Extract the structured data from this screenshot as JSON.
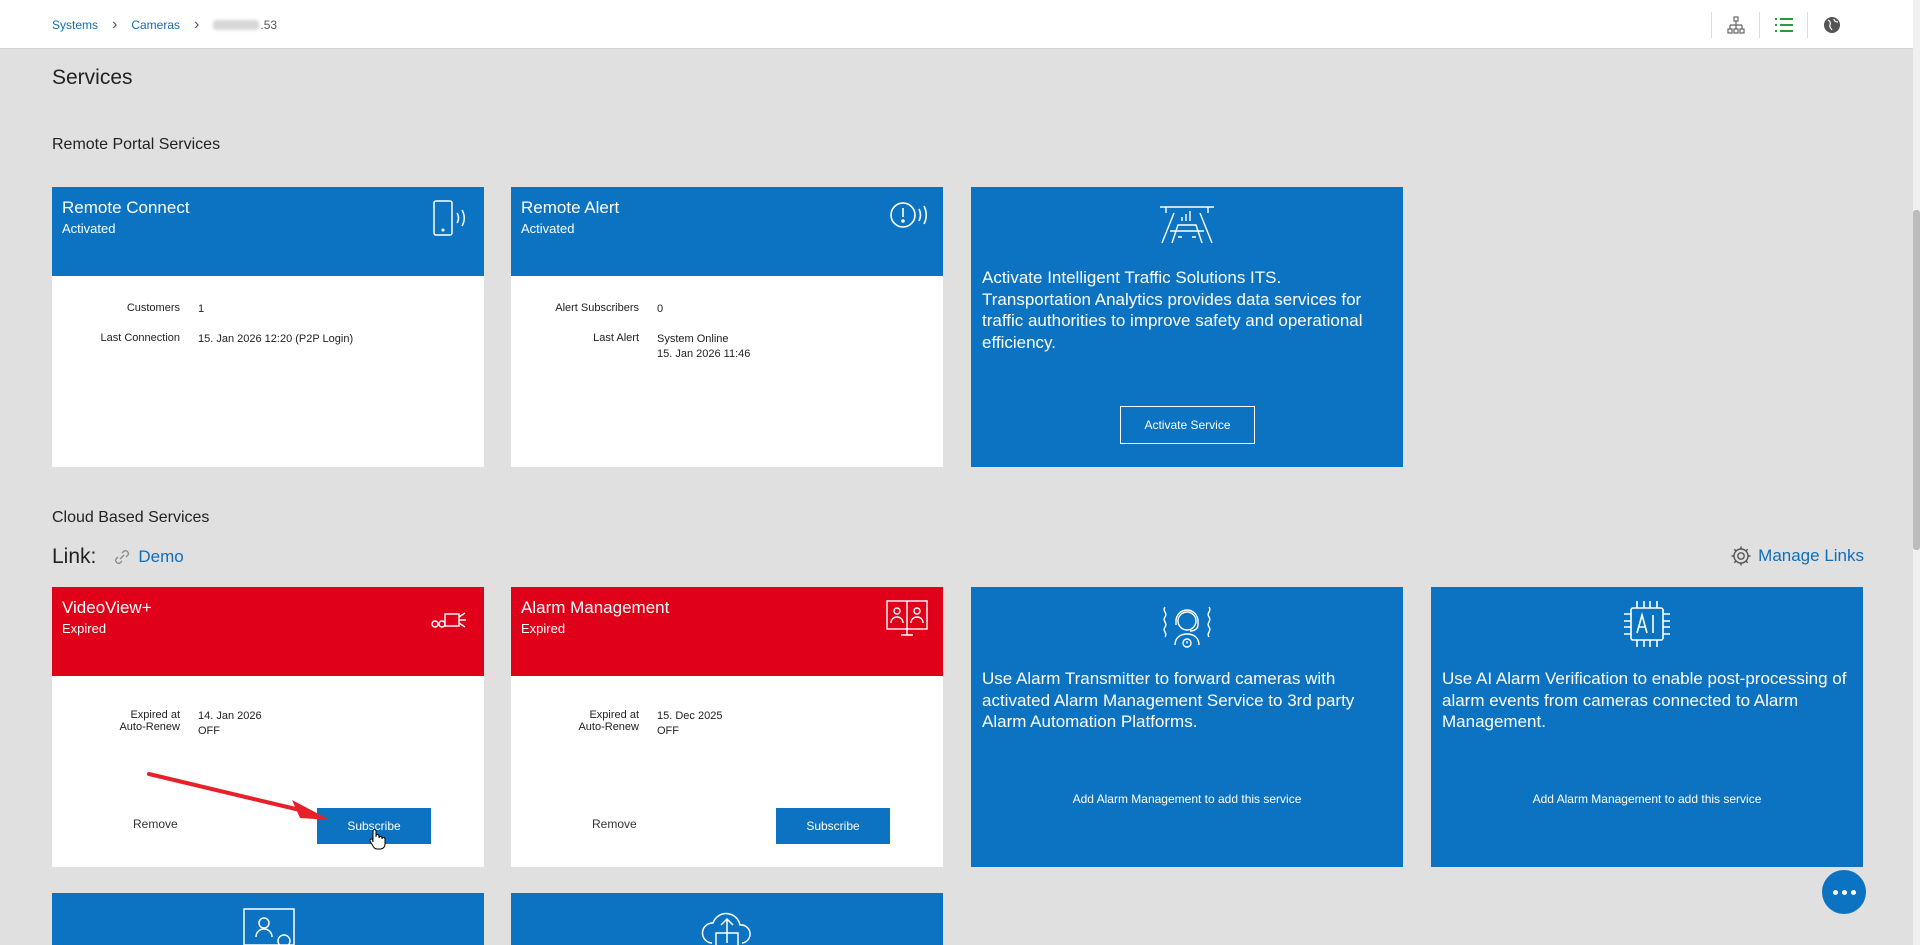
{
  "breadcrumb": {
    "systems": "Systems",
    "cameras": "Cameras",
    "device_suffix": ".53"
  },
  "page": {
    "title": "Services"
  },
  "sections": {
    "remote_portal": "Remote Portal Services",
    "cloud_based": "Cloud Based Services"
  },
  "link_row": {
    "label": "Link:",
    "demo": "Demo",
    "manage": "Manage Links"
  },
  "remote_connect": {
    "title": "Remote Connect",
    "status": "Activated",
    "rows": [
      {
        "label": "Customers",
        "value": "1"
      },
      {
        "label": "Last Connection",
        "value": "15. Jan 2026 12:20 (P2P Login)"
      }
    ]
  },
  "remote_alert": {
    "title": "Remote Alert",
    "status": "Activated",
    "rows": [
      {
        "label": "Alert Subscribers",
        "value": "0"
      },
      {
        "label": "Last Alert",
        "value": "System Online",
        "value2": "15. Jan 2026 11:46"
      }
    ]
  },
  "its_promo": {
    "text": "Activate Intelligent Traffic Solutions ITS. Transportation Analytics provides data services for traffic authorities to improve safety and operational efficiency.",
    "button": "Activate Service"
  },
  "videoview": {
    "title": "VideoView+",
    "status": "Expired",
    "expired_label": "Expired at",
    "expired_value": "14. Jan 2026",
    "renew_label": "Auto-Renew",
    "renew_value": "OFF",
    "remove": "Remove",
    "subscribe": "Subscribe"
  },
  "alarm_mgmt": {
    "title": "Alarm Management",
    "status": "Expired",
    "expired_label": "Expired at",
    "expired_value": "15. Dec 2025",
    "renew_label": "Auto-Renew",
    "renew_value": "OFF",
    "remove": "Remove",
    "subscribe": "Subscribe"
  },
  "alarm_transmitter": {
    "text": "Use Alarm Transmitter to forward cameras with activated Alarm Management Service to 3rd party Alarm Automation Platforms.",
    "note": "Add Alarm Management to add this service"
  },
  "ai_verification": {
    "text": "Use AI Alarm Verification to enable post-processing of alarm events from cameras connected to Alarm Management.",
    "note": "Add Alarm Management to add this service"
  },
  "colors": {
    "primary": "#0b73c2",
    "expired": "#e10019",
    "link": "#0e6eb8",
    "background": "#e0e0e0"
  },
  "icons": [
    "hierarchy-icon",
    "list-icon",
    "globe-icon",
    "phone-signal-icon",
    "alert-signal-icon",
    "traffic-icon",
    "camera-icon",
    "video-monitor-icon",
    "headset-icon",
    "ai-chip-icon",
    "link-icon",
    "gear-icon",
    "more-icon",
    "arrow-annotation",
    "cursor-hand-icon"
  ]
}
